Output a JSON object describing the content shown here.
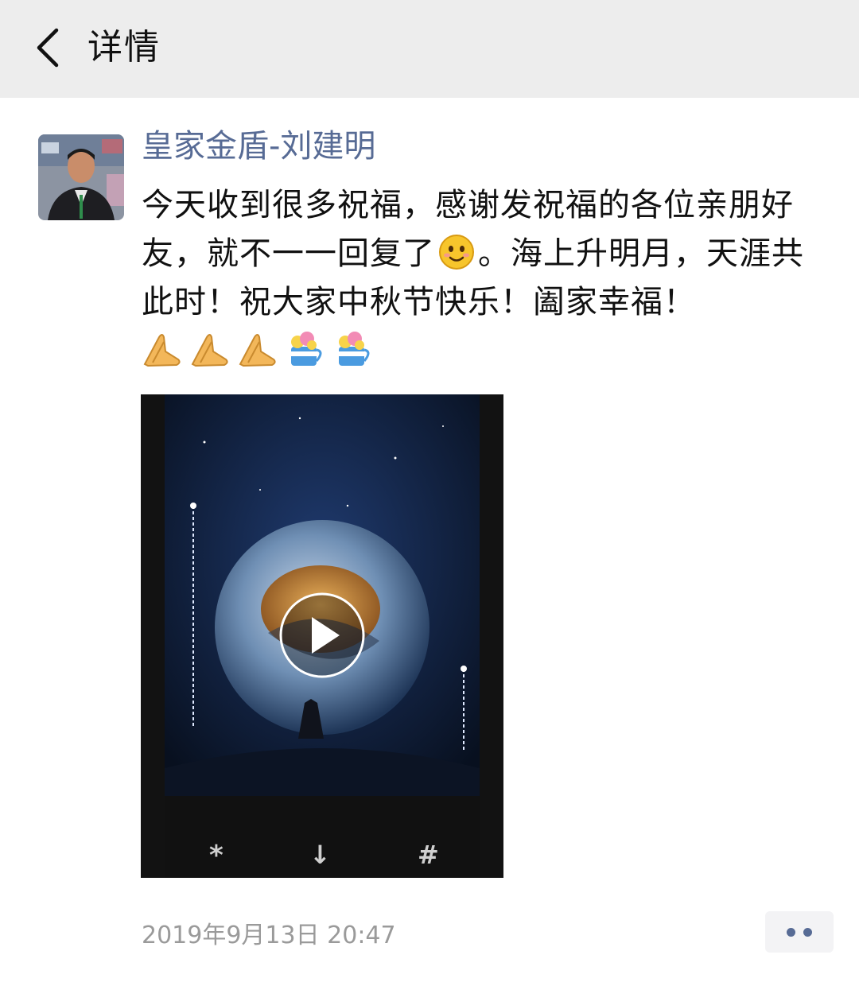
{
  "header": {
    "title": "详情",
    "back_icon": "chevron-left-icon",
    "background": "#ededed"
  },
  "post": {
    "author": "皇家金盾-刘建明",
    "author_color": "#576b95",
    "text_before_emoji": "今天收到很多祝福，感谢发祝福的各位亲朋好友，就不一一回复了",
    "inline_emoji": "smile-emoji-icon",
    "text_after_emoji": "。海上升明月，天涯共此时！祝大家中秋节快乐！阖家幸福！",
    "trailing_emojis": [
      "pray-emoji-icon",
      "pray-emoji-icon",
      "pray-emoji-icon",
      "cake-emoji-icon",
      "cake-emoji-icon"
    ],
    "video": {
      "play_icon": "play-icon",
      "controls": [
        "*",
        "↓",
        "#"
      ]
    },
    "timestamp": "2019年9月13日 20:47",
    "more_icon": "more-dots-icon"
  }
}
